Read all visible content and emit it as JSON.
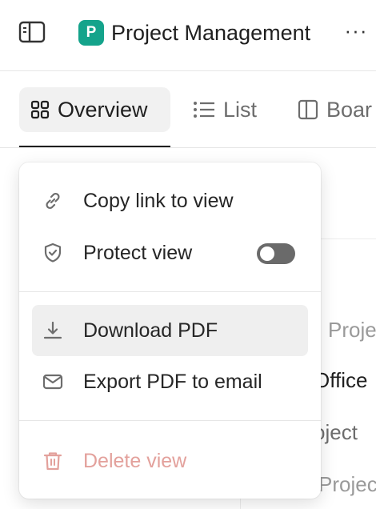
{
  "header": {
    "sidebar_toggle_icon": "sidebar-panel-icon",
    "project_badge": "P",
    "project_badge_color": "#14a38b",
    "project_title": "Project Management",
    "more_label": "···"
  },
  "tabs": [
    {
      "label": "Overview",
      "icon": "grid-icon",
      "active": true
    },
    {
      "label": "List",
      "icon": "list-icon",
      "active": false
    },
    {
      "label": "Boar",
      "icon": "board-icon",
      "active": false
    }
  ],
  "background_rows": [
    "Proje",
    "Office",
    "oject",
    "Projec"
  ],
  "menu": {
    "items": [
      {
        "label": "Copy link to view",
        "icon": "link-icon"
      },
      {
        "label": "Protect view",
        "icon": "shield-check-icon",
        "toggle_on": false
      },
      {
        "label": "Download PDF",
        "icon": "download-icon",
        "highlighted": true
      },
      {
        "label": "Export PDF to email",
        "icon": "mail-icon"
      },
      {
        "label": "Delete view",
        "icon": "trash-icon",
        "disabled": true,
        "color": "#e3a19c"
      }
    ]
  }
}
